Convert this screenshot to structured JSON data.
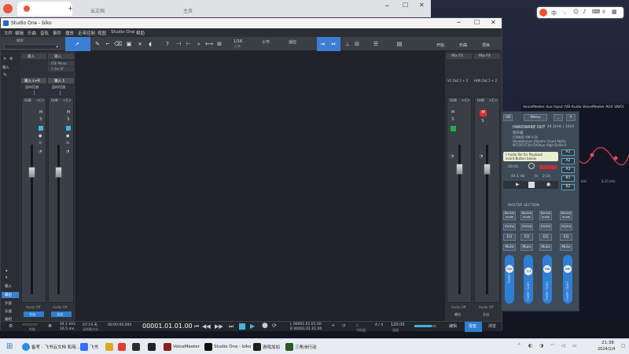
{
  "browser": {
    "tab_title": "飞书",
    "tab2_title": "云文档",
    "tab3_title": "主页"
  },
  "s1": {
    "title": "Studio One - biko",
    "menu": [
      "文件",
      "编辑",
      "乐曲",
      "音轨",
      "事件",
      "播放",
      "走带控制",
      "视图",
      "Studio One",
      "帮助"
    ],
    "tabs_right": [
      "开始",
      "乐曲",
      "项目"
    ],
    "toolbar": {
      "snap_value": "1/16",
      "snap_mode": "小节",
      "quantize": "适应",
      "snap_label": "小节",
      "search_label": "搜索"
    },
    "left_panel": {
      "items": [
        "输入",
        "输出",
        "外部",
        "乐器",
        "编组"
      ],
      "top_label": "输入"
    },
    "mixer": {
      "header1": "输入",
      "header2": "输入",
      "insert1": "FSE Mono",
      "insert2": "1 Ste EF",
      "ch1_name": "输入 L+R",
      "ch2_name": "输入 1",
      "ch_btn": "监听/回放",
      "vol1": "0dB",
      "pan1": "<C>",
      "vol2": "0dB",
      "pan2": "<C>",
      "mute": "M",
      "solo": "S",
      "ch1_footer": "Audio Off",
      "ch2_footer": "Audio Off",
      "ch1_out": "主出",
      "ch2_out": "主出"
    },
    "right_panel": {
      "tab1": "Mix FX",
      "tab2": "Mix FX",
      "ch1_in": "VC Out 1 + 2",
      "ch2_in": "H/W Out 1 + 2",
      "vol": "0dB",
      "pan": "<C>",
      "mute": "M",
      "solo": "S",
      "ch1_footer": "Audio Off",
      "ch2_footer": "Audio Off",
      "ch1_name": "输出",
      "ch2_name": "主出"
    },
    "transport": {
      "sample_rate": "44.1 kHz",
      "buffer": "16.5 ms",
      "max_time": "67:19 天",
      "record_label": "录制最大化",
      "time_a": "00:00:00.000",
      "position": "00001.01.01.00",
      "loop_l": "L 00001.01.01.00",
      "loop_r": "R 00001.01.01.00",
      "time_sig": "4 / 4",
      "tempo": "120.00",
      "meter_label": "节拍器",
      "tempo_label": "速度",
      "bottom_tabs": [
        "编辑",
        "混音",
        "浏览"
      ],
      "label_left": "性能",
      "label_mid": "采样率"
    }
  },
  "voicemeeter": {
    "aux_title": "VoiceMeeter Aux Input (VB-Audio VoiceMeeter AUX VAIO)",
    "title": "Menu",
    "vb_label": "VB",
    "hw_out": "HARDWARE OUT",
    "hw_rate": "44.1kHz | 1024",
    "device1": "扬声器",
    "device2": "(OBNID AM V-O)",
    "device3": "Headphones (Hyperx Cloud Alpha",
    "device4": "WT-DCST3(V-DX)Aux High Dx/Hi-R",
    "cassette_line1": "t Audio file for Playback",
    "cassette_line2": "ecord Button below",
    "time": "00:00",
    "in_label": "In",
    "ch_label": "2 Ch",
    "hz": "44.1 Hz",
    "buses": [
      "A1",
      "A2",
      "A3",
      "B1",
      "B2"
    ],
    "master": "MASTER SECTION",
    "modes": [
      "Normal mode",
      "Normal mode",
      "Normal mode",
      "Normal mode"
    ],
    "mode_labels": [
      "mono",
      "mono",
      "mono",
      "mono"
    ],
    "eq": "EQ",
    "mute": "Mute",
    "gain": "Fader Gain",
    "knob_vals": [
      "0db",
      "-3.3",
      "0db",
      "0db"
    ]
  },
  "aux_eq": {
    "freq_labels": [
      "5 kHz",
      "8.25 kHz"
    ]
  },
  "ime": {
    "lang": "中"
  },
  "taskbar": {
    "items": [
      "备考 - 飞书云文档 和用...",
      "飞书",
      "VoiceMeeter",
      "Studio One - biko",
      "游戏加加",
      "三角洲行动"
    ],
    "time": "21:38",
    "date": "2024/1/4"
  }
}
